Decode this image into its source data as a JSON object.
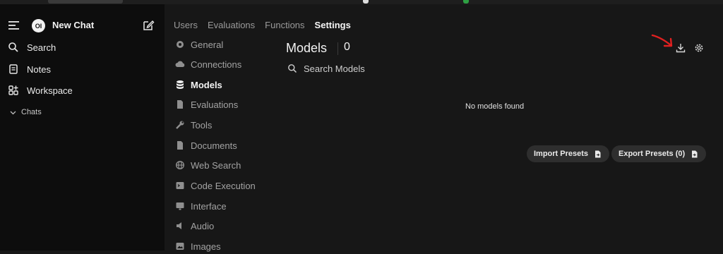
{
  "sidebar": {
    "logo_text": "OI",
    "new_chat": "New Chat",
    "items": [
      {
        "label": "Search",
        "icon": "search-icon"
      },
      {
        "label": "Notes",
        "icon": "notes-icon"
      },
      {
        "label": "Workspace",
        "icon": "workspace-icon"
      }
    ],
    "chats_label": "Chats"
  },
  "tabs": [
    {
      "label": "Users",
      "active": false
    },
    {
      "label": "Evaluations",
      "active": false
    },
    {
      "label": "Functions",
      "active": false
    },
    {
      "label": "Settings",
      "active": true
    }
  ],
  "settings_nav": [
    {
      "label": "General",
      "icon": "gear-icon"
    },
    {
      "label": "Connections",
      "icon": "cloud-icon"
    },
    {
      "label": "Models",
      "icon": "database-icon",
      "active": true
    },
    {
      "label": "Evaluations",
      "icon": "document-icon"
    },
    {
      "label": "Tools",
      "icon": "wrench-icon"
    },
    {
      "label": "Documents",
      "icon": "document-icon"
    },
    {
      "label": "Web Search",
      "icon": "globe-icon"
    },
    {
      "label": "Code Execution",
      "icon": "terminal-icon"
    },
    {
      "label": "Interface",
      "icon": "monitor-icon"
    },
    {
      "label": "Audio",
      "icon": "speaker-icon"
    },
    {
      "label": "Images",
      "icon": "image-icon"
    }
  ],
  "main": {
    "title": "Models",
    "count": "0",
    "search_placeholder": "Search Models",
    "empty_text": "No models found",
    "import_presets": "Import Presets",
    "export_presets": "Export Presets (0)"
  },
  "colors": {
    "background": "#171717",
    "sidebar": "#0d0d0d",
    "button": "#2e2e2e",
    "annotation_arrow": "#e02020"
  }
}
